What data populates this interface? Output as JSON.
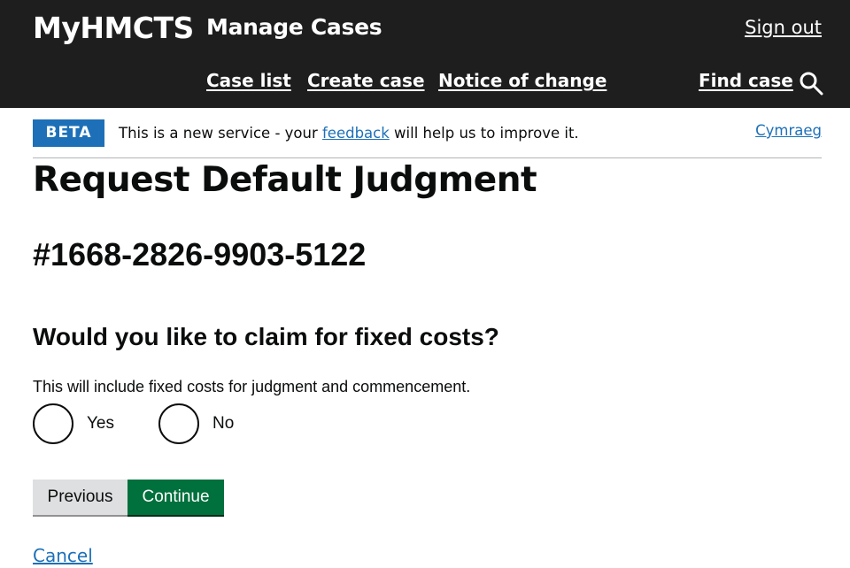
{
  "header": {
    "brand": "MyHMCTS",
    "service_name": "Manage Cases",
    "sign_out": "Sign out",
    "nav": [
      "Case list",
      "Create case",
      "Notice of change"
    ],
    "find_case": "Find case",
    "search_icon": "search-icon",
    "background_color": "#1e1e1e"
  },
  "phase_banner": {
    "tag": "BETA",
    "text_before": "This is a new service - your ",
    "link": "feedback",
    "text_after": " will help us to improve it.",
    "language_link": "Cymraeg",
    "tag_color": "#1d70b8"
  },
  "main": {
    "title": "Request Default Judgment",
    "case_reference": "#1668-2826-9903-5122",
    "question": "Would you like to claim for fixed costs?",
    "hint": "This will include fixed costs for judgment and commencement.",
    "options": [
      "Yes",
      "No"
    ],
    "selected": null
  },
  "actions": {
    "previous": "Previous",
    "continue": "Continue",
    "cancel": "Cancel",
    "continue_color": "#00703c",
    "link_color": "#1d70b8"
  }
}
